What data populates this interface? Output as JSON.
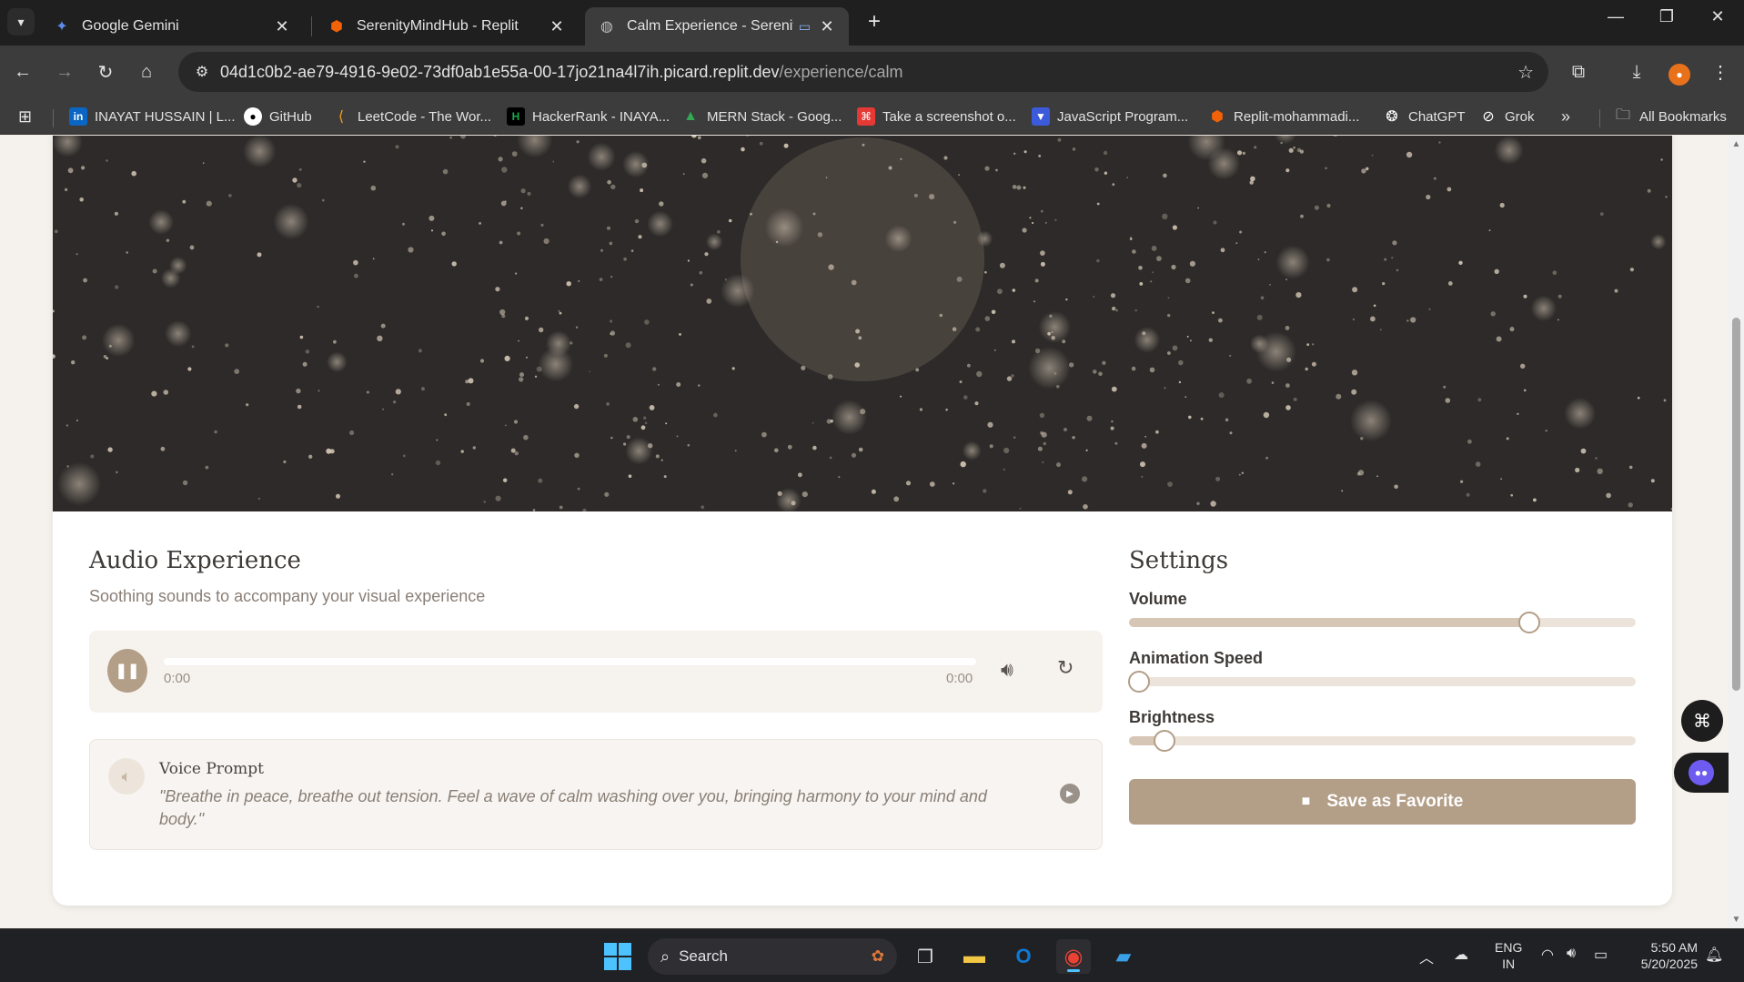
{
  "browser": {
    "tabs": [
      {
        "title": "Google Gemini",
        "icon": "gemini-icon",
        "active": false
      },
      {
        "title": "SerenityMindHub - Replit",
        "icon": "replit-icon",
        "active": false
      },
      {
        "title": "Calm Experience - Serenity",
        "icon": "globe-icon",
        "active": true
      }
    ],
    "url_host": "04d1c0b2-ae79-4916-9e02-73df0ab1e55a-00-17jo21na4l7ih.picard.replit.dev",
    "url_path": "/experience/calm",
    "bookmarks": [
      {
        "label": "INAYAT HUSSAIN | L...",
        "icon": "linkedin-icon",
        "color": "#0a66c2"
      },
      {
        "label": "GitHub",
        "icon": "github-icon",
        "color": "#ffffff"
      },
      {
        "label": "LeetCode - The Wor...",
        "icon": "leetcode-icon",
        "color": "#f89f1b"
      },
      {
        "label": "HackerRank - INAYA...",
        "icon": "hackerrank-icon",
        "color": "#1ba94c"
      },
      {
        "label": "MERN Stack - Goog...",
        "icon": "google-drive-icon",
        "color": "#34a853"
      },
      {
        "label": "Take a screenshot o...",
        "icon": "screenshot-icon",
        "color": "#e53935"
      },
      {
        "label": "JavaScript Program...",
        "icon": "javascript-icon",
        "color": "#3b5bdb"
      },
      {
        "label": "Replit-mohammadi...",
        "icon": "replit-icon",
        "color": "#f26207"
      },
      {
        "label": "ChatGPT",
        "icon": "chatgpt-icon",
        "color": "#ffffff"
      },
      {
        "label": "Grok",
        "icon": "grok-icon",
        "color": "#ffffff"
      }
    ],
    "all_bookmarks_label": "All Bookmarks"
  },
  "page": {
    "audio": {
      "title": "Audio Experience",
      "subtitle": "Soothing sounds to accompany your visual experience",
      "current_time": "0:00",
      "duration": "0:00"
    },
    "voice_prompt": {
      "title": "Voice Prompt",
      "text": "\"Breathe in peace, breathe out tension. Feel a wave of calm washing over you, bringing harmony to your mind and body.\""
    },
    "settings": {
      "title": "Settings",
      "sliders": [
        {
          "label": "Volume",
          "value": 0.79
        },
        {
          "label": "Animation Speed",
          "value": 0.02
        },
        {
          "label": "Brightness",
          "value": 0.07
        }
      ],
      "save_label": "Save as Favorite"
    },
    "colors": {
      "accent": "#b39e87",
      "canvas_bg": "#2d2a29",
      "particle": "#d8cbb8"
    }
  },
  "taskbar": {
    "search_placeholder": "Search",
    "language": "ENG",
    "region": "IN",
    "time": "5:50 AM",
    "date": "5/20/2025"
  }
}
